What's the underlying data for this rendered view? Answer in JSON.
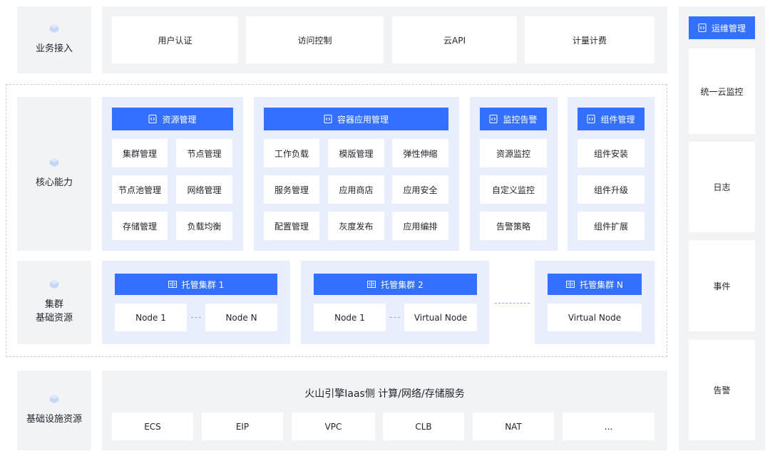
{
  "colors": {
    "accent": "#3370ff",
    "panel_grey": "#f2f3f5",
    "panel_blue": "#e8eefb"
  },
  "rows": {
    "access": "业务接入",
    "core": "核心能力",
    "cluster_line1": "集群",
    "cluster_line2": "基础资源",
    "infra": "基础设施资源"
  },
  "access_items": [
    "用户认证",
    "访问控制",
    "云API",
    "计量计费"
  ],
  "core": {
    "resource": {
      "title": "资源管理",
      "items": [
        "集群管理",
        "节点管理",
        "节点池管理",
        "网络管理",
        "存储管理",
        "负载均衡"
      ]
    },
    "container": {
      "title": "容器应用管理",
      "items": [
        "工作负载",
        "模版管理",
        "弹性伸缩",
        "服务管理",
        "应用商店",
        "应用安全",
        "配置管理",
        "灰度发布",
        "应用编排"
      ]
    },
    "monitor": {
      "title": "监控告警",
      "items": [
        "资源监控",
        "自定义监控",
        "告警策略"
      ]
    },
    "component": {
      "title": "组件管理",
      "items": [
        "组件安装",
        "组件升级",
        "组件扩展"
      ]
    }
  },
  "clusters": {
    "c1": {
      "title": "托管集群 1",
      "left": "Node 1",
      "right": "Node N"
    },
    "c2": {
      "title": "托管集群 2",
      "left": "Node 1",
      "right": "Virtual Node"
    },
    "cn": {
      "title": "托管集群 N",
      "single": "Virtual Node"
    }
  },
  "infra": {
    "title": "火山引擎Iaas侧 计算/网络/存储服务",
    "items": [
      "ECS",
      "EIP",
      "VPC",
      "CLB",
      "NAT",
      "..."
    ]
  },
  "ops": {
    "title": "运维管理",
    "items": [
      "统一云监控",
      "日志",
      "事件",
      "告警"
    ]
  }
}
